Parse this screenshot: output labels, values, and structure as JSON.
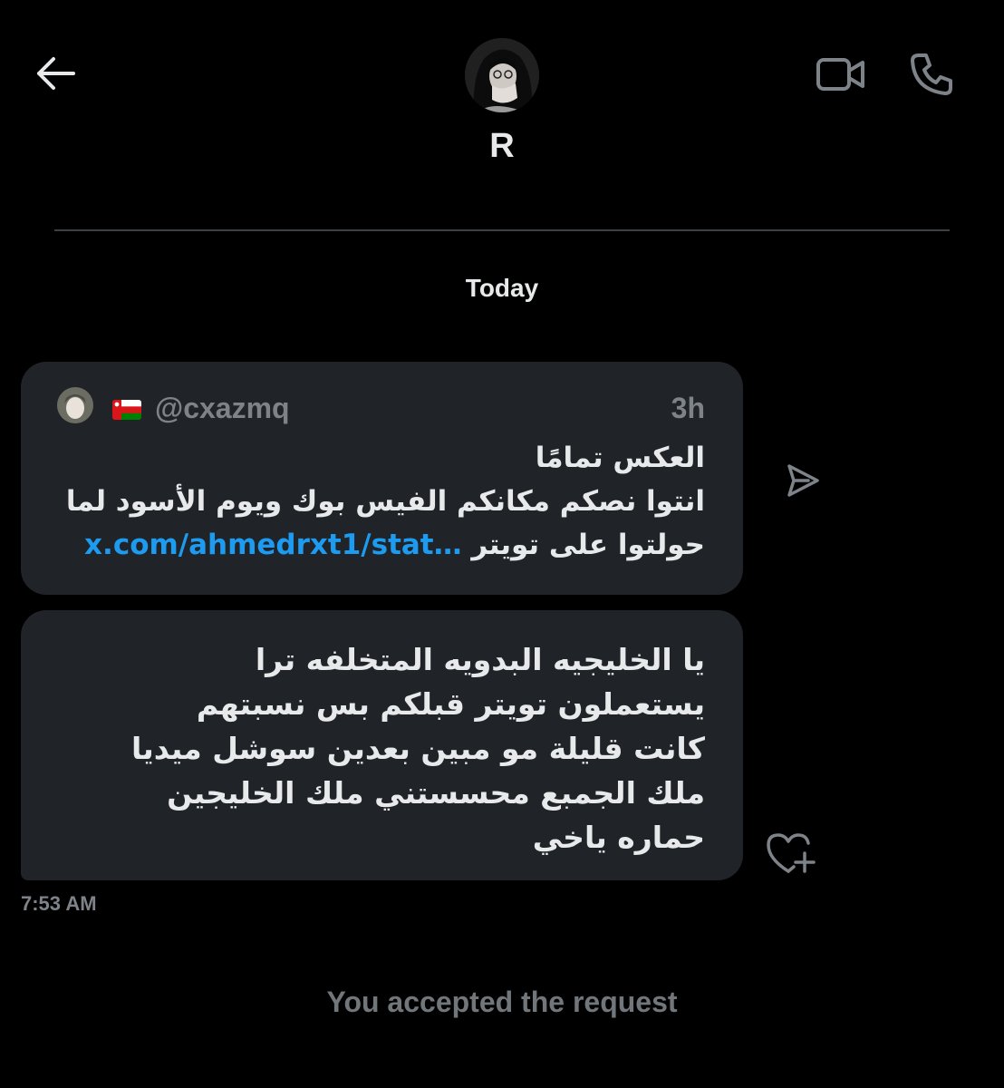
{
  "header": {
    "back_icon": "arrow-left-icon",
    "contact_name": "R",
    "video_icon": "video-camera-icon",
    "call_icon": "phone-icon"
  },
  "conversation": {
    "date_separator": "Today",
    "messages": [
      {
        "type": "quoted-post",
        "handle": "@cxazmq",
        "flag": "Oman",
        "time_ago": "3h",
        "lines": [
          "العكس تمامًا",
          "انتوا نصكم مكانكم الفيس بوك ويوم الأسود لما",
          "حولتوا على تويتر"
        ],
        "link_text": "x.com/ahmedrxt1/stat…",
        "action_icon": "share-icon"
      },
      {
        "type": "text",
        "lines": [
          "يا الخليجيه البدويه المتخلفه ترا",
          "يستعملون تويتر قبلكم بس نسبتهم",
          "كانت قليلة مو مبين بعدين سوشل ميديا",
          "ملك الجمبع محسستني ملك الخليجين",
          "حماره ياخي"
        ],
        "reaction_icon": "heart-plus-icon"
      }
    ],
    "timestamp": "7:53 AM",
    "system_message": "You accepted the request"
  },
  "colors": {
    "background": "#000000",
    "bubble": "#202327",
    "text": "#e7e9ea",
    "muted": "#7d8389",
    "link": "#1d9bf0",
    "divider": "#3e4144"
  }
}
